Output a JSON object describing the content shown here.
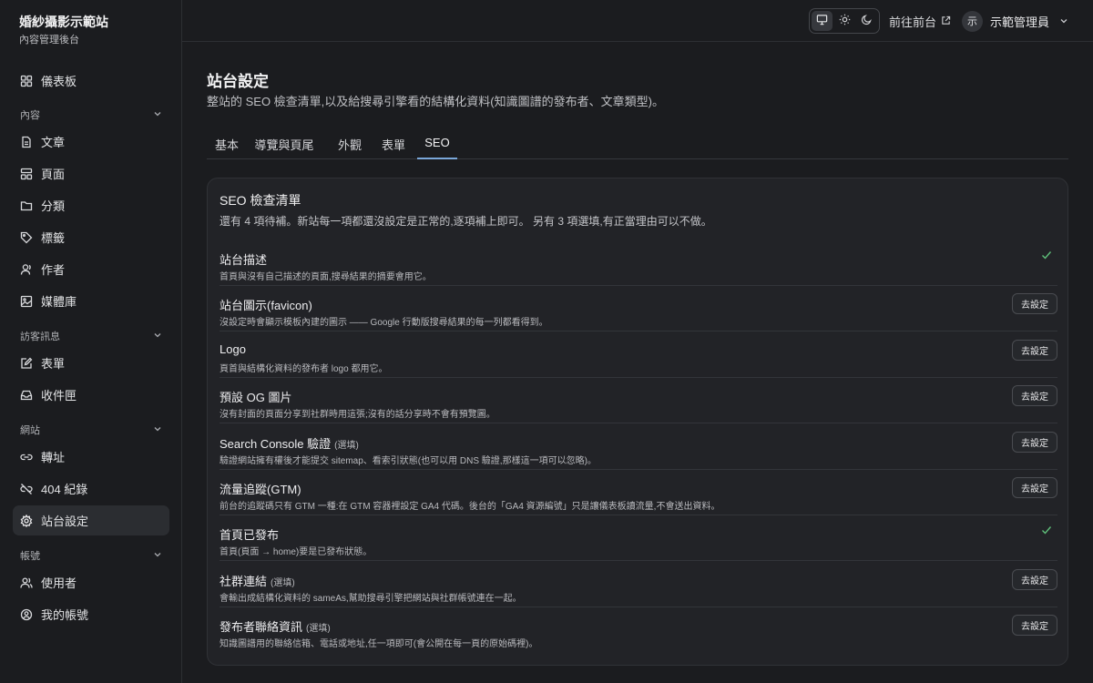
{
  "brand": {
    "title": "婚紗攝影示範站",
    "subtitle": "內容管理後台"
  },
  "sidebar": {
    "items": [
      {
        "label": "儀表板"
      },
      {
        "label": "文章"
      },
      {
        "label": "頁面"
      },
      {
        "label": "分類"
      },
      {
        "label": "標籤"
      },
      {
        "label": "作者"
      },
      {
        "label": "媒體庫"
      },
      {
        "label": "表單"
      },
      {
        "label": "收件匣"
      },
      {
        "label": "轉址"
      },
      {
        "label": "404 紀錄"
      },
      {
        "label": "站台設定"
      },
      {
        "label": "使用者"
      },
      {
        "label": "我的帳號"
      }
    ],
    "groups": [
      {
        "label": "內容"
      },
      {
        "label": "訪客訊息"
      },
      {
        "label": "網站"
      },
      {
        "label": "帳號"
      }
    ]
  },
  "topbar": {
    "front_link": "前往前台",
    "user_initial": "示",
    "user_name": "示範管理員"
  },
  "page": {
    "title": "站台設定",
    "description": "整站的 SEO 檢查清單,以及給搜尋引擎看的結構化資料(知識圖譜的發布者、文章類型)。",
    "tabs": [
      {
        "label": "基本"
      },
      {
        "label": "導覽與頁尾"
      },
      {
        "label": "外觀"
      },
      {
        "label": "表單"
      },
      {
        "label": "SEO"
      }
    ],
    "active_tab": "SEO"
  },
  "checklist": {
    "title": "SEO 檢查清單",
    "summary": "還有 4 項待補。新站每一項都還沒設定是正常的,逐項補上即可。 另有 3 項選填,有正當理由可以不做。",
    "button_label": "去設定",
    "optional_label": "(選填)",
    "items": [
      {
        "title": "站台描述",
        "desc": "首頁與沒有自己描述的頁面,搜尋結果的摘要會用它。",
        "done": true,
        "optional": false
      },
      {
        "title": "站台圖示(favicon)",
        "desc": "沒設定時會顯示模板內建的圖示 —— Google 行動版搜尋結果的每一列都看得到。",
        "done": false,
        "optional": false
      },
      {
        "title": "Logo",
        "desc": "頁首與結構化資料的發布者 logo 都用它。",
        "done": false,
        "optional": false
      },
      {
        "title": "預設 OG 圖片",
        "desc": "沒有封面的頁面分享到社群時用這張;沒有的話分享時不會有預覽圖。",
        "done": false,
        "optional": false
      },
      {
        "title": "Search Console 驗證",
        "desc": "驗證網站擁有權後才能提交 sitemap、看索引狀態(也可以用 DNS 驗證,那樣這一項可以忽略)。",
        "done": false,
        "optional": true
      },
      {
        "title": "流量追蹤(GTM)",
        "desc": "前台的追蹤碼只有 GTM 一種:在 GTM 容器裡設定 GA4 代碼。後台的「GA4 資源編號」只是讓儀表板讀流量,不會送出資料。",
        "done": false,
        "optional": false
      },
      {
        "title": "首頁已發布",
        "desc": "首頁(頁面 → home)要是已發布狀態。",
        "done": true,
        "optional": false
      },
      {
        "title": "社群連結",
        "desc": "會輸出成結構化資料的 sameAs,幫助搜尋引擎把網站與社群帳號連在一起。",
        "done": false,
        "optional": true
      },
      {
        "title": "發布者聯絡資訊",
        "desc": "知識圖譜用的聯絡信箱、電話或地址,任一項即可(會公開在每一頁的原始碼裡)。",
        "done": false,
        "optional": true
      }
    ]
  },
  "colors": {
    "accent": "#7aa7d9",
    "check": "#5fbf7a"
  }
}
